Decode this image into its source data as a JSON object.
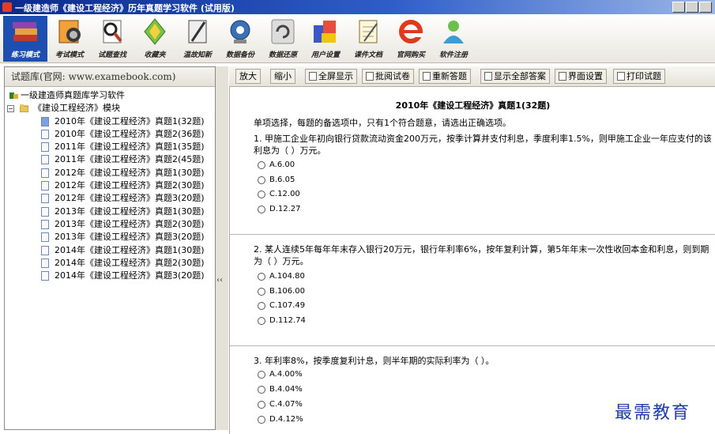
{
  "window": {
    "title": "一级建造师《建设工程经济》历年真题学习软件 (试用版)"
  },
  "toolbar": {
    "items": [
      {
        "label": "练习模式",
        "icon": "books-icon"
      },
      {
        "label": "考试模式",
        "icon": "exam-icon"
      },
      {
        "label": "试题查找",
        "icon": "search-icon"
      },
      {
        "label": "收藏夹",
        "icon": "favorites-icon"
      },
      {
        "label": "温故知新",
        "icon": "review-icon"
      },
      {
        "label": "数据备份",
        "icon": "backup-icon"
      },
      {
        "label": "数据还原",
        "icon": "restore-icon"
      },
      {
        "label": "用户设置",
        "icon": "settings-icon"
      },
      {
        "label": "课件文档",
        "icon": "document-icon"
      },
      {
        "label": "官网购买",
        "icon": "ie-icon"
      },
      {
        "label": "软件注册",
        "icon": "register-icon"
      }
    ]
  },
  "left": {
    "header": "试题库(官网: www.examebook.com)",
    "root": "一级建造师真题库学习软件",
    "module": "《建设工程经济》模块",
    "items": [
      "2010年《建设工程经济》真题1(32题)",
      "2010年《建设工程经济》真题2(36题)",
      "2011年《建设工程经济》真题1(35题)",
      "2011年《建设工程经济》真题2(45题)",
      "2012年《建设工程经济》真题1(30题)",
      "2012年《建设工程经济》真题2(30题)",
      "2012年《建设工程经济》真题3(20题)",
      "2013年《建设工程经济》真题1(30题)",
      "2013年《建设工程经济》真题2(30题)",
      "2013年《建设工程经济》真题3(20题)",
      "2014年《建设工程经济》真题1(30题)",
      "2014年《建设工程经济》真题2(30题)",
      "2014年《建设工程经济》真题3(20题)"
    ]
  },
  "right_toolbar": {
    "zoom_in": "放大",
    "zoom_out": "缩小",
    "fullscreen": "全屏显示",
    "grade": "批阅试卷",
    "redo": "重新答题",
    "show_answers": "显示全部答案",
    "ui_settings": "界面设置",
    "print": "打印试题"
  },
  "content": {
    "paper_title": "2010年《建设工程经济》真题1(32题)",
    "instruction": "单项选择，每题的备选项中，只有1个符合题意，请选出正确选项。",
    "questions": [
      {
        "lines": [
          "1. 甲施工企业年初向银行贷款流动资金200万元，按季计算并支付利息，季度利率1.5%，则甲施工企业一年应支付的该",
          "利息为（ ）万元。"
        ],
        "options": [
          "A.6.00",
          "B.6.05",
          "C.12.00",
          "D.12.27"
        ]
      },
      {
        "lines": [
          "2. 某人连续5年每年年末存入银行20万元，银行年利率6%，按年复利计算，第5年年末一次性收回本金和利息，则到期",
          "为（ ）万元。"
        ],
        "options": [
          "A.104.80",
          "B.106.00",
          "C.107.49",
          "D.112.74"
        ]
      },
      {
        "lines": [
          "3. 年利率8%，按季度复利计息，则半年期的实际利率为（ ）。"
        ],
        "options": [
          "A.4.00%",
          "B.4.04%",
          "C.4.07%",
          "D.4.12%"
        ]
      }
    ]
  },
  "watermark": "最需教育",
  "colors": {
    "selected_tool": "#1d4fb0",
    "title_bar": "#0b2a8a",
    "watermark": "#1f3da8"
  }
}
